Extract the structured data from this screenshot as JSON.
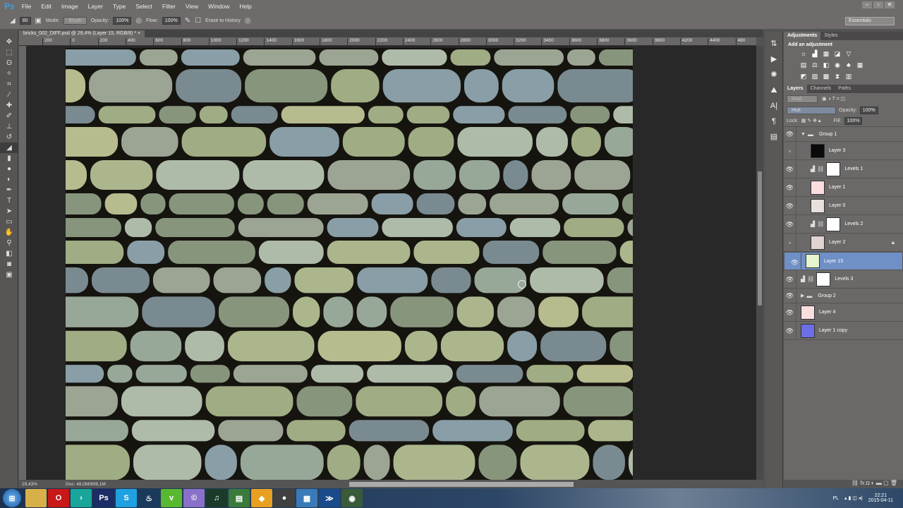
{
  "app": {
    "logo": "Ps",
    "menu": [
      "File",
      "Edit",
      "Image",
      "Layer",
      "Type",
      "Select",
      "Filter",
      "View",
      "Window",
      "Help"
    ],
    "workspace": "Essentials"
  },
  "options": {
    "brush_size": "80",
    "mode_label": "Mode:",
    "mode_value": "Brush",
    "opacity_label": "Opacity:",
    "opacity_value": "100%",
    "flow_label": "Flow:",
    "flow_value": "100%",
    "erase_history_label": "Erase to History"
  },
  "document": {
    "tab_title": "bricks_002_DIFF.psd @ 29,4% (Layer 15, RGB/8) *",
    "zoom": "29,43%",
    "doc_size": "Doc: 48,0M/806,1M"
  },
  "ruler": [
    "200",
    "0",
    "200",
    "400",
    "600",
    "800",
    "1000",
    "1200",
    "1400",
    "1600",
    "1800",
    "2000",
    "2200",
    "2400",
    "2600",
    "2800",
    "3000",
    "3200",
    "3400",
    "3600",
    "3800",
    "3600",
    "3800",
    "4200",
    "4400",
    "480"
  ],
  "adjustments": {
    "tabs": [
      "Adjustments",
      "Styles"
    ],
    "title": "Add an adjustment"
  },
  "layers_panel": {
    "tabs": [
      "Layers",
      "Channels",
      "Paths"
    ],
    "filter": "Kind",
    "blend_mode": "Hue",
    "opacity_label": "Opacity:",
    "opacity_value": "100%",
    "lock_label": "Lock:",
    "fill_label": "Fill:",
    "fill_value": "100%",
    "layers": [
      {
        "name": "Group 1",
        "type": "group",
        "visible": true
      },
      {
        "name": "Layer 3",
        "visible": false,
        "thumb": "#0a0a0a"
      },
      {
        "name": "Levels 1",
        "type": "adjustment",
        "visible": true
      },
      {
        "name": "Layer 1",
        "visible": true,
        "thumb": "#fbdede"
      },
      {
        "name": "Layer 0",
        "visible": true,
        "thumb": "#e8e0dc"
      },
      {
        "name": "Levels 2",
        "type": "adjustment",
        "visible": true
      },
      {
        "name": "Layer 2",
        "visible": false,
        "thumb": "#e0d4d0",
        "locked": true
      },
      {
        "name": "Layer 15",
        "visible": true,
        "thumb": "#e6f3cf",
        "selected": true
      },
      {
        "name": "Levels 3",
        "type": "adjustment",
        "visible": true
      },
      {
        "name": "Group 2",
        "type": "group",
        "visible": true
      },
      {
        "name": "Layer 4",
        "visible": true,
        "thumb": "#fbdede"
      },
      {
        "name": "Layer 1 copy",
        "visible": true,
        "thumb": "#6d6ee8"
      }
    ]
  },
  "taskbar": {
    "lang": "PL",
    "time": "22:21",
    "date": "2015-04-11",
    "apps": [
      {
        "label": "",
        "color": "#d8b04a",
        "icon": "folder-icon"
      },
      {
        "label": "O",
        "color": "#c81818",
        "icon": "opera-icon"
      },
      {
        "label": "›",
        "color": "#1aa59a",
        "icon": "arrow-app-icon"
      },
      {
        "label": "Ps",
        "color": "#1b2c66",
        "icon": "photoshop-icon"
      },
      {
        "label": "S",
        "color": "#1fa0e0",
        "icon": "skype-icon"
      },
      {
        "label": "♨",
        "color": "#1a3a5c",
        "icon": "steam-icon"
      },
      {
        "label": "v",
        "color": "#58b830",
        "icon": "vine-icon"
      },
      {
        "label": "©",
        "color": "#8a70c8",
        "icon": "torrent-icon"
      },
      {
        "label": "♫",
        "color": "#1a3a2a",
        "icon": "spotify-icon"
      },
      {
        "label": "▤",
        "color": "#3a7a3a",
        "icon": "app-icon"
      },
      {
        "label": "◆",
        "color": "#e8a020",
        "icon": "app2-icon"
      },
      {
        "label": "●",
        "color": "#404040",
        "icon": "app3-icon"
      },
      {
        "label": "▦",
        "color": "#3a7ab8",
        "icon": "app4-icon"
      },
      {
        "label": "≫",
        "color": "#1a4a8a",
        "icon": "app5-icon"
      },
      {
        "label": "◉",
        "color": "#3a5a3a",
        "icon": "app6-icon"
      }
    ]
  }
}
